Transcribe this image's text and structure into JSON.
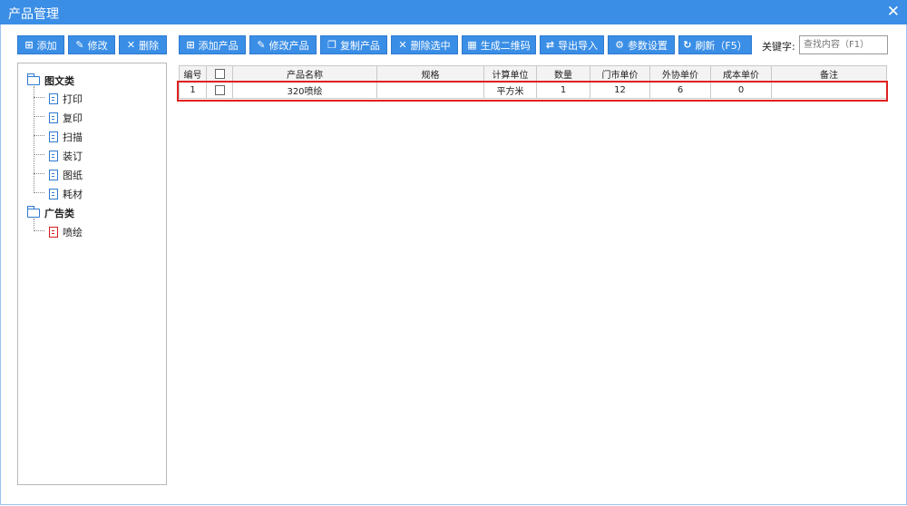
{
  "window": {
    "title": "产品管理",
    "close": "✕"
  },
  "left_toolbar": {
    "add": "添加",
    "edit": "修改",
    "delete": "删除"
  },
  "toolbar": {
    "add_product": "添加产品",
    "edit_product": "修改产品",
    "copy_product": "复制产品",
    "delete_selected": "删除选中",
    "qrcode": "生成二维码",
    "export_import": "导出导入",
    "settings": "参数设置",
    "refresh": "刷新（F5）"
  },
  "search": {
    "label": "关键字:",
    "placeholder": "查找内容（F1）"
  },
  "tree": {
    "groups": [
      {
        "label": "图文类",
        "items": [
          "打印",
          "复印",
          "扫描",
          "装订",
          "图纸",
          "耗材"
        ]
      },
      {
        "label": "广告类",
        "items": [
          "喷绘"
        ]
      }
    ]
  },
  "table": {
    "headers": [
      "编号",
      "",
      "产品名称",
      "规格",
      "计算单位",
      "数量",
      "门市单价",
      "外协单价",
      "成本单价",
      "备注"
    ],
    "rows": [
      [
        "1",
        "",
        "320喷绘",
        "",
        "平方米",
        "1",
        "12",
        "6",
        "0",
        ""
      ]
    ]
  },
  "colors": {
    "accent": "#3a8ee6",
    "highlight": "#e02020",
    "leaf_icon_red": "#d51f1f"
  },
  "icons": {
    "close": "close-icon",
    "add": "add-icon",
    "edit": "edit-icon",
    "delete": "delete-icon",
    "copy": "copy-icon",
    "qrcode": "qrcode-icon",
    "export": "export-icon",
    "gear": "gear-icon",
    "refresh": "refresh-icon",
    "folder": "folder-icon",
    "document": "document-icon"
  }
}
